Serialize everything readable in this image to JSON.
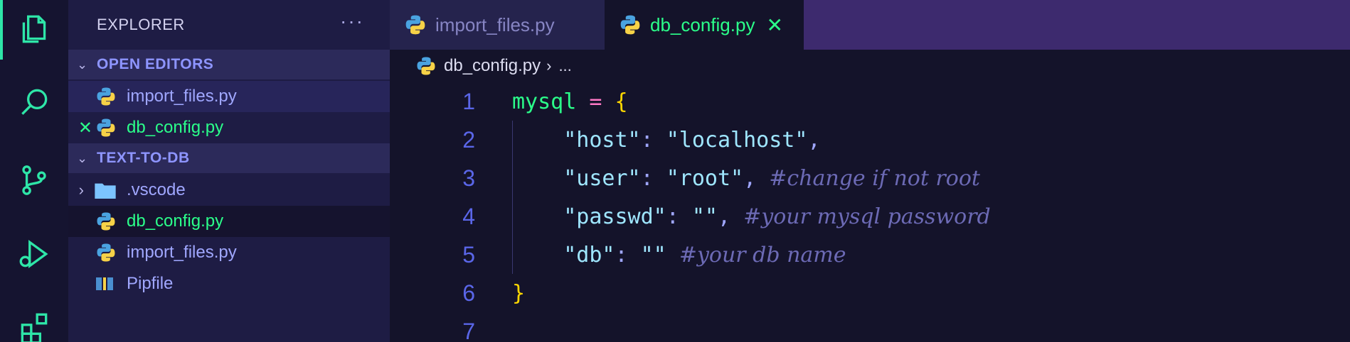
{
  "sidebar": {
    "title": "EXPLORER",
    "more": "···",
    "open_editors": {
      "label": "OPEN EDITORS",
      "items": [
        {
          "label": "import_files.py"
        },
        {
          "label": "db_config.py"
        }
      ]
    },
    "project": {
      "label": "TEXT-TO-DB",
      "items": [
        {
          "label": ".vscode"
        },
        {
          "label": "db_config.py"
        },
        {
          "label": "import_files.py"
        },
        {
          "label": "Pipfile"
        }
      ]
    }
  },
  "tabs": [
    {
      "label": "import_files.py",
      "active": false
    },
    {
      "label": "db_config.py",
      "active": true
    }
  ],
  "breadcrumb": {
    "file": "db_config.py",
    "rest": "..."
  },
  "editor": {
    "line_numbers": [
      "1",
      "2",
      "3",
      "4",
      "5",
      "6",
      "7"
    ],
    "l1": {
      "var": "mysql",
      "op": "=",
      "brace": "{"
    },
    "l2": {
      "key": "\"host\"",
      "colon": ": ",
      "val": "\"localhost\"",
      "comma": ","
    },
    "l3": {
      "key": "\"user\"",
      "colon": ": ",
      "val": "\"root\"",
      "comma": ",",
      "comment": "#change if not root"
    },
    "l4": {
      "key": "\"passwd\"",
      "colon": ": ",
      "val": "\"\"",
      "comma": ",",
      "comment": "#your mysql password"
    },
    "l5": {
      "key": "\"db\"",
      "colon": ": ",
      "val": "\"\"",
      "comment": "#your db name"
    },
    "l6": {
      "brace": "}"
    }
  },
  "colors": {
    "accent": "#2ee6a8",
    "active_file": "#2bff8a",
    "folder_label": "#a0a7ff",
    "tab_bar": "#3d2a6e",
    "sidebar_bg": "#1e1c44",
    "editor_bg": "#14132a"
  },
  "icons": {
    "activity": [
      "files-icon",
      "search-icon",
      "source-control-icon",
      "run-debug-icon",
      "extensions-icon"
    ],
    "file": "python-file-icon",
    "folder": "folder-icon",
    "pipfile": "pipfile-icon"
  }
}
